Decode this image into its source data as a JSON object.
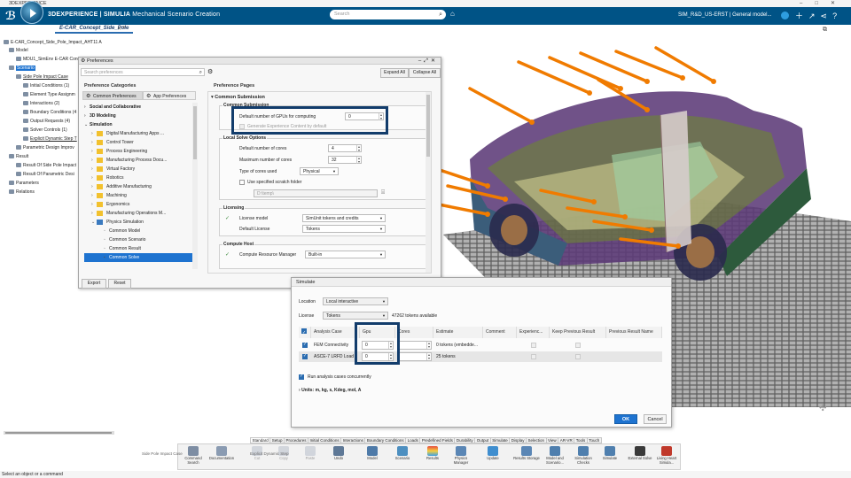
{
  "window": {
    "title": "3DEXPERIENCE",
    "controls": [
      "–",
      "□",
      "✕"
    ]
  },
  "header": {
    "brand_bold": "3DEXPERIENCE | SIMULIA",
    "brand_app": "Mechanical Scenario Creation",
    "search_placeholder": "Search",
    "user": "SIM_R&D_US-ERST | General model...",
    "accent": "#005386"
  },
  "doc_tab": {
    "label": "E-CAR_Concept_Side_Pole"
  },
  "tree": {
    "items": [
      {
        "label": "E-CAR_Concept_Side_Pole_Impact_AHT11 A"
      },
      {
        "label": "Model"
      },
      {
        "label": "MDU1_SimEnv E-CAR Conc"
      },
      {
        "label": "Scenario"
      },
      {
        "label": "Side Pole Impact Case"
      },
      {
        "label": "Initial Conditions (1)"
      },
      {
        "label": "Element Type Assignm"
      },
      {
        "label": "Interactions (2)"
      },
      {
        "label": "Boundary Conditions (4"
      },
      {
        "label": "Output Requests (4)"
      },
      {
        "label": "Solver Controls (1)"
      },
      {
        "label": "Explicit Dynamic Step T"
      },
      {
        "label": "Parametric Design Improv"
      },
      {
        "label": "Result"
      },
      {
        "label": "Result Of Side Pole Impact"
      },
      {
        "label": "Result Of Parametric Desi"
      },
      {
        "label": "Parameters"
      },
      {
        "label": "Relations"
      }
    ]
  },
  "preferences": {
    "title": "Preferences",
    "search_placeholder": "Search preferences",
    "expand_all": "Expand All",
    "collapse_all": "Collapse All",
    "categories_title": "Preference Categories",
    "tab_common": "Common Preferences",
    "tab_app": "App Preferences",
    "categories": [
      {
        "label": "Social and Collaborative",
        "bold": true
      },
      {
        "label": "3D Modeling",
        "bold": true
      },
      {
        "label": "Simulation",
        "bold": true
      },
      {
        "label": "Digital Manufacturing Apps ..."
      },
      {
        "label": "Control Tower"
      },
      {
        "label": "Process Engineering"
      },
      {
        "label": "Manufacturing Process Docu..."
      },
      {
        "label": "Virtual Factory"
      },
      {
        "label": "Robotics"
      },
      {
        "label": "Additive Manufacturing"
      },
      {
        "label": "Machining"
      },
      {
        "label": "Ergonomics"
      },
      {
        "label": "Manufacturing Operations M..."
      },
      {
        "label": "Physics Simulation"
      },
      {
        "label": "Common Model"
      },
      {
        "label": "Common Scenario"
      },
      {
        "label": "Common Result"
      },
      {
        "label": "Common Solve"
      }
    ],
    "pages_title": "Preference Pages",
    "common_submission": "Common Submission",
    "grp_common_submission": "Common Submission",
    "gpu_label": "Default number of GPUs for computing",
    "gpu_value": "0",
    "gen_exp_label": "Generate Experience Content by default",
    "grp_local": "Local Solve Options",
    "num_cores_label": "Default number of cores",
    "num_cores_value": "4",
    "max_cores_label": "Maximum number of cores",
    "max_cores_value": "32",
    "type_cores_label": "Type of cores used",
    "type_cores_value": "Physical",
    "scratch_label": "Use specified scratch folder",
    "scratch_path": "D:\\temp\\",
    "grp_licensing": "Licensing",
    "license_model_label": "License model",
    "license_model_value": "SimUnit tokens and credits",
    "default_license_label": "Default License",
    "default_license_value": "Tokens",
    "grp_compute": "Compute Host",
    "compute_mgr_label": "Compute Resource Manager",
    "compute_mgr_value": "Built-in",
    "export": "Export",
    "reset": "Reset"
  },
  "simulate": {
    "title": "Simulate",
    "location_label": "Location",
    "location_value": "Local interactive",
    "license_label": "License",
    "license_value": "Tokens",
    "tokens_available": "47262 tokens available",
    "columns": [
      "Analysis Case",
      "Gpu",
      "Cores",
      "Estimate",
      "Comment",
      "Experienc...",
      "Keep Previous Result",
      "Previous Result Name"
    ],
    "rows": [
      {
        "case": "FEM Connectivity",
        "gpu": "0",
        "cores": "",
        "estimate": "0 tokens (embedde..."
      },
      {
        "case": "ASCE-7 LRFD Load",
        "gpu": "0",
        "cores": "",
        "estimate": "25 tokens"
      }
    ],
    "concurrent_label": "Run analysis cases concurrently",
    "units": "Units: m, kg, s, Kdeg, mol, A",
    "ok": "OK",
    "cancel": "Cancel"
  },
  "action_tabs": [
    "Standard",
    "Setup",
    "Procedures",
    "Initial Conditions",
    "Interactions",
    "Boundary Conditions",
    "Loads",
    "Predefined Fields",
    "Durability",
    "Output",
    "Simulate",
    "Display",
    "Selection",
    "View",
    "AR-VR",
    "Tools",
    "Touch"
  ],
  "toolbar": [
    {
      "label": "Command Search",
      "icon": "search-icon"
    },
    {
      "label": "Documentation",
      "icon": "book-icon"
    },
    {
      "label": "Cut",
      "icon": "cut-icon"
    },
    {
      "label": "Copy",
      "icon": "copy-icon"
    },
    {
      "label": "Paste",
      "icon": "paste-icon"
    },
    {
      "label": "Undo",
      "icon": "undo-icon"
    },
    {
      "label": "Model",
      "icon": "model-icon"
    },
    {
      "label": "Scenario",
      "icon": "scenario-icon"
    },
    {
      "label": "Results",
      "icon": "results-icon"
    },
    {
      "label": "Physics Manager",
      "icon": "physics-manager-icon"
    },
    {
      "label": "Update",
      "icon": "update-icon"
    },
    {
      "label": "Results Storage",
      "icon": "results-storage-icon"
    },
    {
      "label": "Model and Scenario...",
      "icon": "model-scenario-icon"
    },
    {
      "label": "Simulation Checks",
      "icon": "simulation-checks-icon"
    },
    {
      "label": "Simulate",
      "icon": "simulate-icon"
    },
    {
      "label": "External Solve",
      "icon": "external-solve-icon"
    },
    {
      "label": "Living Heart Simula...",
      "icon": "living-heart-icon"
    }
  ],
  "faded_case": "Side Pole Impact Case",
  "faded_explicit": "Explicit Dynamic Step",
  "status": "Select an object or a command"
}
